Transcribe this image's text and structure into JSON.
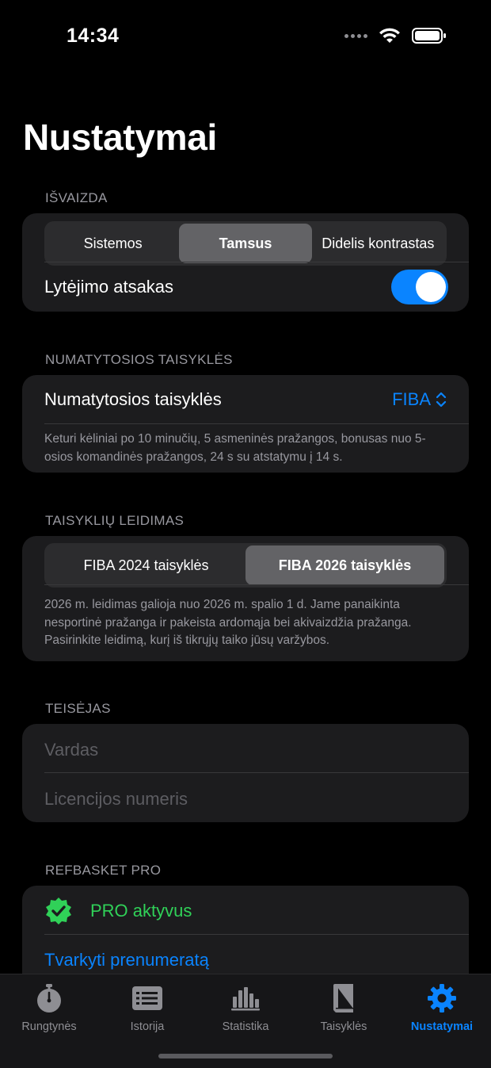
{
  "status_bar": {
    "time": "14:34"
  },
  "page": {
    "title": "Nustatymai"
  },
  "appearance": {
    "header": "IŠVAIZDA",
    "options": [
      "Sistemos",
      "Tamsus",
      "Didelis kontrastas"
    ],
    "selected_index": 1,
    "haptics_label": "Lytėjimo atsakas",
    "haptics_on": true
  },
  "default_rules": {
    "header": "NUMATYTOSIOS TAISYKLĖS",
    "row_label": "Numatytosios taisyklės",
    "value": "FIBA",
    "footnote": "Keturi kėliniai po 10 minučių, 5 asmeninės pražangos, bonusas nuo 5-osios komandinės pražangos, 24 s su atstatymu į 14 s."
  },
  "rules_edition": {
    "header": "TAISYKLIŲ LEIDIMAS",
    "options": [
      "FIBA 2024 taisyklės",
      "FIBA 2026 taisyklės"
    ],
    "selected_index": 1,
    "footnote": "2026 m. leidimas galioja nuo 2026 m. spalio 1 d. Jame panaikinta nesportinė pražanga ir pakeista ardomąja bei akivaizdžia pražanga. Pasirinkite leidimą, kurį iš tikrųjų taiko jūsų varžybos."
  },
  "referee": {
    "header": "TEISĖJAS",
    "name_placeholder": "Vardas",
    "license_placeholder": "Licencijos numeris"
  },
  "pro": {
    "header": "REFBASKET PRO",
    "status": "PRO aktyvus",
    "manage_link": "Tvarkyti prenumeratą"
  },
  "tabs": [
    {
      "label": "Rungtynės",
      "icon": "stopwatch-icon"
    },
    {
      "label": "Istorija",
      "icon": "list-icon"
    },
    {
      "label": "Statistika",
      "icon": "chart-icon"
    },
    {
      "label": "Taisyklės",
      "icon": "book-icon"
    },
    {
      "label": "Nustatymai",
      "icon": "gear-icon",
      "active": true
    }
  ],
  "colors": {
    "accent": "#0a84ff",
    "success": "#30d158",
    "card": "#1c1c1e",
    "background": "#000000"
  }
}
